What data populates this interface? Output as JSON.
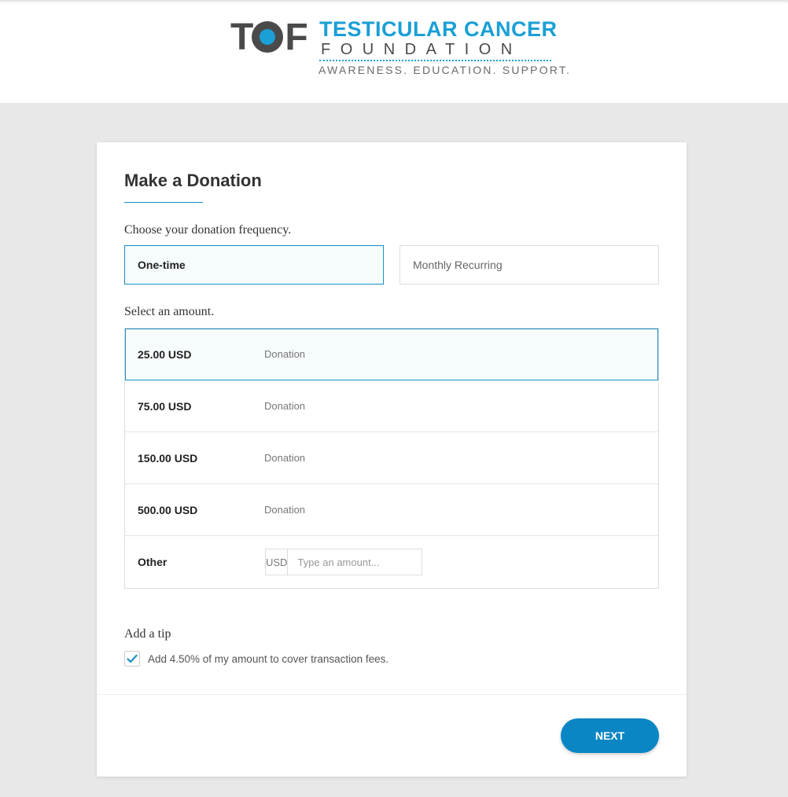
{
  "header": {
    "logo_mark_left": "T",
    "logo_mark_right": "F",
    "org_name": "TESTICULAR CANCER",
    "org_sub": "FOUNDATION",
    "tagline": "AWARENESS. EDUCATION. SUPPORT."
  },
  "form": {
    "title": "Make a Donation",
    "frequency_label": "Choose your donation frequency.",
    "frequency_options": [
      "One-time",
      "Monthly Recurring"
    ],
    "frequency_selected": "One-time",
    "amount_label": "Select an amount.",
    "amounts": [
      {
        "value": "25.00 USD",
        "type": "Donation"
      },
      {
        "value": "75.00 USD",
        "type": "Donation"
      },
      {
        "value": "150.00 USD",
        "type": "Donation"
      },
      {
        "value": "500.00 USD",
        "type": "Donation"
      }
    ],
    "amount_selected": "25.00 USD",
    "other": {
      "label": "Other",
      "currency": "USD",
      "placeholder": "Type an amount..."
    },
    "tip_label": "Add a tip",
    "tip_text": "Add 4.50% of my amount to cover transaction fees.",
    "tip_checked": true,
    "next_label": "NEXT"
  },
  "colors": {
    "accent": "#1a8fc2",
    "brand_blue": "#1a9fd6",
    "button": "#0a86c4"
  }
}
